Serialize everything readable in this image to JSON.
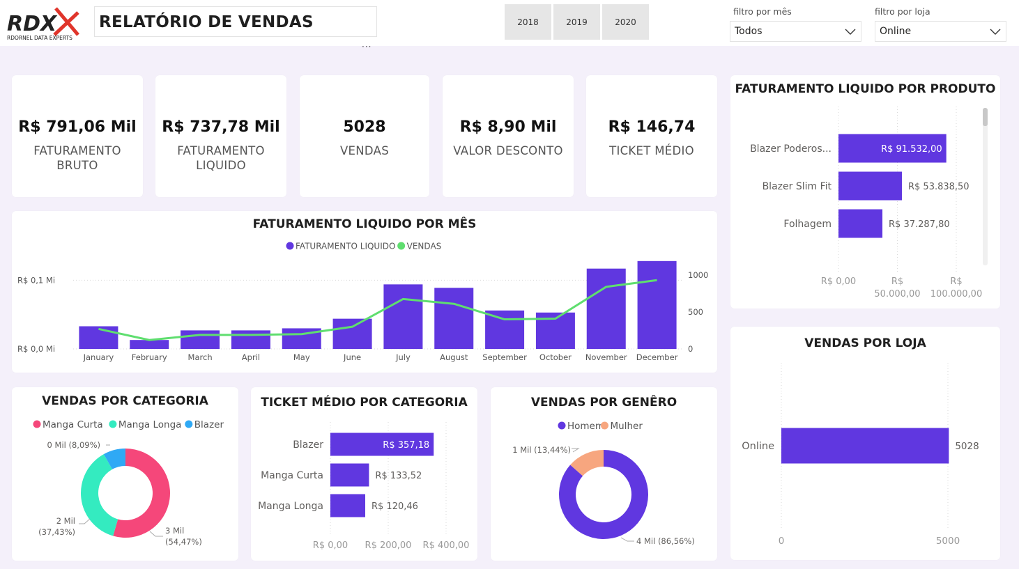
{
  "header": {
    "logo_text": "RDX",
    "logo_subtitle": "RDORNEL DATA EXPERTS",
    "title": "RELATÓRIO DE VENDAS",
    "years": [
      "2018",
      "2019",
      "2020"
    ],
    "more_options": "···",
    "month_filter": {
      "label": "filtro por mês",
      "value": "Todos"
    },
    "store_filter": {
      "label": "filtro por loja",
      "value": "Online"
    }
  },
  "kpis": [
    {
      "value": "R$ 791,06 Mil",
      "label_line1": "FATURAMENTO",
      "label_line2": "BRUTO"
    },
    {
      "value": "R$ 737,78 Mil",
      "label_line1": "FATURAMENTO",
      "label_line2": "LIQUIDO"
    },
    {
      "value": "5028",
      "label_line1": "VENDAS",
      "label_line2": ""
    },
    {
      "value": "R$ 8,90 Mil",
      "label_line1": "VALOR DESCONTO",
      "label_line2": ""
    },
    {
      "value": "R$ 146,74",
      "label_line1": "TICKET MÉDIO",
      "label_line2": ""
    }
  ],
  "colors": {
    "purple": "#6037e0",
    "green": "#5fde6f",
    "pink": "#f5477a",
    "teal": "#34ebc0",
    "blue": "#2fa9f5",
    "peach": "#f7a67f"
  },
  "chart_data": [
    {
      "type": "bar",
      "title": "FATURAMENTO LIQUIDO POR MÊS",
      "categories": [
        "January",
        "February",
        "March",
        "April",
        "May",
        "June",
        "July",
        "August",
        "September",
        "October",
        "November",
        "December"
      ],
      "series": [
        {
          "name": "FATURAMENTO LIQUIDO",
          "values": [
            0.033,
            0.013,
            0.027,
            0.027,
            0.03,
            0.044,
            0.094,
            0.089,
            0.056,
            0.053,
            0.117,
            0.128
          ]
        },
        {
          "name": "VENDAS",
          "values": [
            270,
            120,
            190,
            190,
            200,
            300,
            675,
            610,
            400,
            410,
            840,
            930
          ]
        }
      ],
      "y_left_ticks": [
        "R$ 0,0 Mi",
        "R$ 0,1 Mi"
      ],
      "y_right_ticks": [
        "0",
        "500",
        "1000"
      ],
      "ylim_left": [
        0,
        0.14
      ],
      "ylim_right": [
        0,
        1300
      ],
      "legend": "top-center"
    },
    {
      "type": "bar",
      "orientation": "horizontal",
      "title": "FATURAMENTO LIQUIDO POR PRODUTO",
      "categories": [
        "Blazer Poderos...",
        "Blazer Slim Fit",
        "Folhagem"
      ],
      "values": [
        91532.0,
        53838.5,
        37287.8
      ],
      "labels": [
        "R$ 91.532,00",
        "R$ 53.838,50",
        "R$ 37.287,80"
      ],
      "x_ticks": [
        "R$ 0,00",
        "R$ 50.000,00",
        "R$ 100.000,00"
      ],
      "xlim": [
        0,
        100000
      ]
    },
    {
      "type": "bar",
      "orientation": "horizontal",
      "title": "VENDAS POR LOJA",
      "categories": [
        "Online"
      ],
      "values": [
        5028
      ],
      "labels": [
        "5028"
      ],
      "x_ticks": [
        "0",
        "5000"
      ],
      "xlim": [
        0,
        5000
      ]
    },
    {
      "type": "pie",
      "style": "donut",
      "title": "VENDAS POR CATEGORIA",
      "categories": [
        "Manga Curta",
        "Manga Longa",
        "Blazer"
      ],
      "values": [
        54.47,
        37.43,
        8.09
      ],
      "labels": [
        "3 Mil (54,47%)",
        "2 Mil (37,43%)",
        "0 Mil (8,09%)"
      ],
      "legend": "top"
    },
    {
      "type": "bar",
      "orientation": "horizontal",
      "title": "TICKET MÉDIO POR CATEGORIA",
      "categories": [
        "Blazer",
        "Manga Curta",
        "Manga Longa"
      ],
      "values": [
        357.18,
        133.52,
        120.46
      ],
      "labels": [
        "R$ 357,18",
        "R$ 133,52",
        "R$ 120,46"
      ],
      "x_ticks": [
        "R$ 0,00",
        "R$ 200,00",
        "R$ 400,00"
      ],
      "xlim": [
        0,
        400
      ]
    },
    {
      "type": "pie",
      "style": "donut",
      "title": "VENDAS POR GENÊRO",
      "categories": [
        "Homem",
        "Mulher"
      ],
      "values": [
        86.56,
        13.44
      ],
      "labels": [
        "4 Mil (86,56%)",
        "1 Mil (13,44%)"
      ],
      "legend": "top"
    }
  ]
}
